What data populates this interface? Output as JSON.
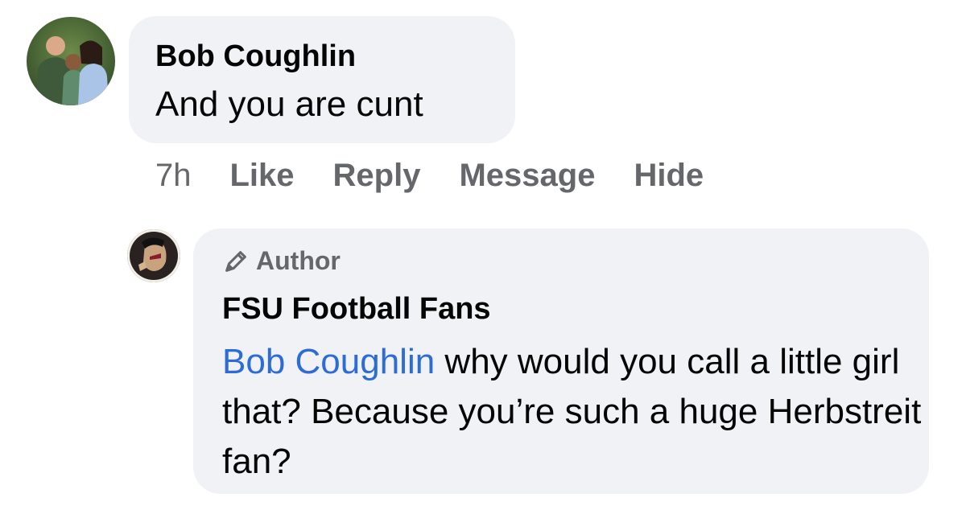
{
  "comment": {
    "author": "Bob Coughlin",
    "text": "And you are cunt",
    "time": "7h",
    "actions": {
      "like": "Like",
      "reply": "Reply",
      "message": "Message",
      "hide": "Hide"
    }
  },
  "reply": {
    "badge": "Author",
    "badge_icon": "pencil-icon",
    "author": "FSU Football Fans",
    "mention": "Bob Coughlin",
    "text": " why would you call a little girl that? Because you’re such a huge Herbstreit fan?"
  },
  "colors": {
    "bubble": "#f0f2f5",
    "muted_text": "#65676b",
    "mention": "#2d6bd6",
    "text": "#050505"
  }
}
